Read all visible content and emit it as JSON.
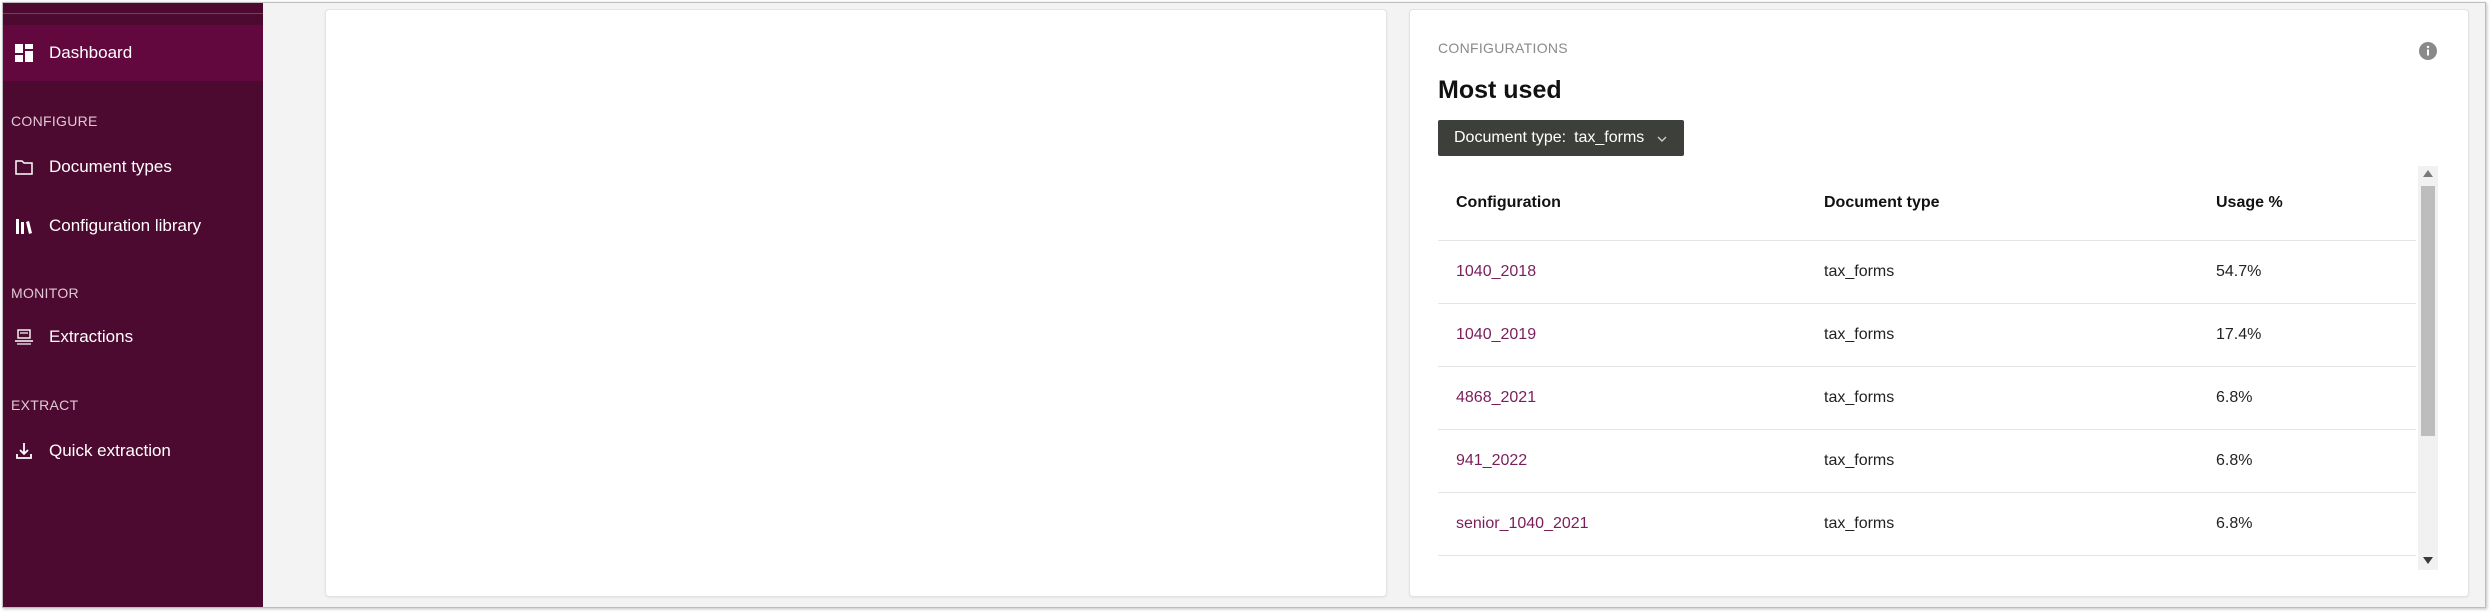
{
  "sidebar": {
    "items": {
      "dashboard": {
        "label": "Dashboard",
        "icon": "dashboard-icon"
      },
      "document_types": {
        "label": "Document types",
        "icon": "folder-icon"
      },
      "configuration_library": {
        "label": "Configuration library",
        "icon": "library-icon"
      },
      "extractions": {
        "label": "Extractions",
        "icon": "extraction-icon"
      },
      "quick_extraction": {
        "label": "Quick extraction",
        "icon": "download-icon"
      }
    },
    "sections": {
      "configure": "CONFIGURE",
      "monitor": "MONITOR",
      "extract": "EXTRACT"
    }
  },
  "most_used": {
    "eyebrow": "CONFIGURATIONS",
    "title": "Most used",
    "filter": {
      "label": "Document type:",
      "value": "tax_forms"
    },
    "columns": {
      "configuration": "Configuration",
      "document_type": "Document type",
      "usage": "Usage %"
    },
    "rows": [
      {
        "configuration": "1040_2018",
        "document_type": "tax_forms",
        "usage": "54.7%"
      },
      {
        "configuration": "1040_2019",
        "document_type": "tax_forms",
        "usage": "17.4%"
      },
      {
        "configuration": "4868_2021",
        "document_type": "tax_forms",
        "usage": "6.8%"
      },
      {
        "configuration": "941_2022",
        "document_type": "tax_forms",
        "usage": "6.8%"
      },
      {
        "configuration": "senior_1040_2021",
        "document_type": "tax_forms",
        "usage": "6.8%"
      }
    ]
  },
  "colors": {
    "sidebar_bg": "#4d0a30",
    "sidebar_active": "#63073f",
    "link": "#7a1e5a",
    "button_bg": "#3d3f3a"
  }
}
